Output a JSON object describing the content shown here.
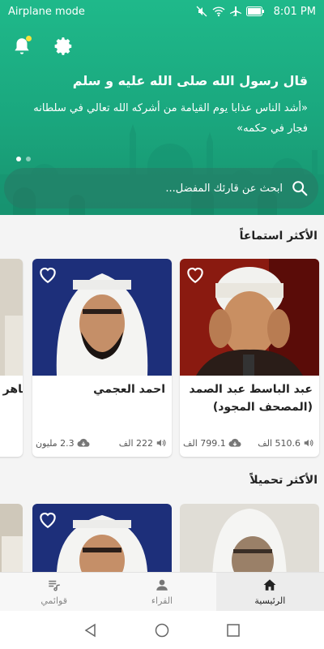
{
  "status_bar": {
    "mode": "Airplane mode",
    "battery_icon": "battery-icon",
    "time": "8:01 PM"
  },
  "header": {
    "hadith_title": "قال رسول الله صلى الله عليه و سلم",
    "hadith_text": "«أشد الناس عذابا يوم القيامة من أشركه الله تعالي في سلطانه فجار في حكمه»",
    "search_placeholder": "ابحث عن قارئك المفضل..."
  },
  "sections": {
    "most_listened_title": "الأكثر استماعاً",
    "most_downloaded_title": "الأكثر تحميلاً"
  },
  "most_listened": [
    {
      "name": "عبد الباسط عبد الصمد (المصحف المجود)",
      "plays": "510.6 الف",
      "downloads": "799.1 الف"
    },
    {
      "name": "احمد العجمي",
      "plays": "222 الف",
      "downloads": "2.3 مليون"
    },
    {
      "name": "ماهر"
    }
  ],
  "bottom_nav": {
    "home": "الرئيسية",
    "reciters": "القراء",
    "playlists": "قوائمي"
  },
  "colors": {
    "accent": "#1fb98a",
    "text": "#222222"
  }
}
